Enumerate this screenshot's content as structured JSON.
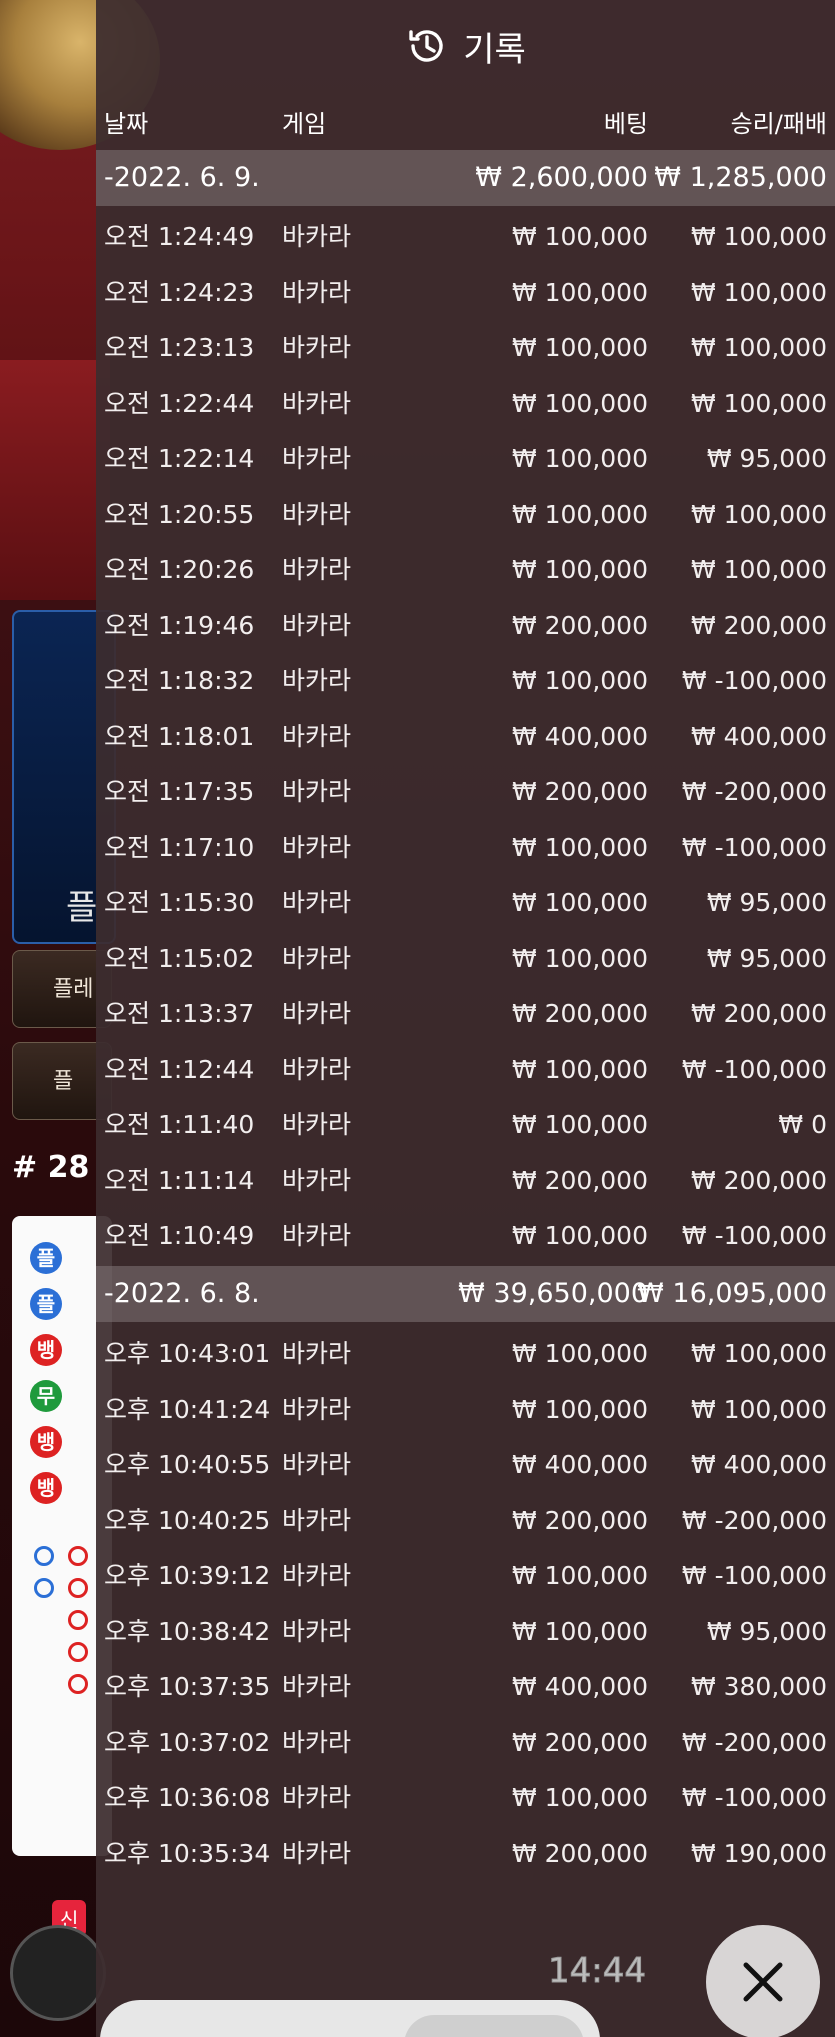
{
  "header": {
    "title": "기록"
  },
  "columns": {
    "date": "날짜",
    "game": "게임",
    "bet": "베팅",
    "result": "승리/패배"
  },
  "sections": [
    {
      "date": "-2022. 6. 9.",
      "bet_total": "₩ 2,600,000",
      "result_total": "₩ 1,285,000",
      "rows": [
        {
          "time": "오전 1:24:49",
          "game": "바카라",
          "bet": "₩ 100,000",
          "result": "₩ 100,000"
        },
        {
          "time": "오전 1:24:23",
          "game": "바카라",
          "bet": "₩ 100,000",
          "result": "₩ 100,000"
        },
        {
          "time": "오전 1:23:13",
          "game": "바카라",
          "bet": "₩ 100,000",
          "result": "₩ 100,000"
        },
        {
          "time": "오전 1:22:44",
          "game": "바카라",
          "bet": "₩ 100,000",
          "result": "₩ 100,000"
        },
        {
          "time": "오전 1:22:14",
          "game": "바카라",
          "bet": "₩ 100,000",
          "result": "₩ 95,000"
        },
        {
          "time": "오전 1:20:55",
          "game": "바카라",
          "bet": "₩ 100,000",
          "result": "₩ 100,000"
        },
        {
          "time": "오전 1:20:26",
          "game": "바카라",
          "bet": "₩ 100,000",
          "result": "₩ 100,000"
        },
        {
          "time": "오전 1:19:46",
          "game": "바카라",
          "bet": "₩ 200,000",
          "result": "₩ 200,000"
        },
        {
          "time": "오전 1:18:32",
          "game": "바카라",
          "bet": "₩ 100,000",
          "result": "₩ -100,000"
        },
        {
          "time": "오전 1:18:01",
          "game": "바카라",
          "bet": "₩ 400,000",
          "result": "₩ 400,000"
        },
        {
          "time": "오전 1:17:35",
          "game": "바카라",
          "bet": "₩ 200,000",
          "result": "₩ -200,000"
        },
        {
          "time": "오전 1:17:10",
          "game": "바카라",
          "bet": "₩ 100,000",
          "result": "₩ -100,000"
        },
        {
          "time": "오전 1:15:30",
          "game": "바카라",
          "bet": "₩ 100,000",
          "result": "₩ 95,000"
        },
        {
          "time": "오전 1:15:02",
          "game": "바카라",
          "bet": "₩ 100,000",
          "result": "₩ 95,000"
        },
        {
          "time": "오전 1:13:37",
          "game": "바카라",
          "bet": "₩ 200,000",
          "result": "₩ 200,000"
        },
        {
          "time": "오전 1:12:44",
          "game": "바카라",
          "bet": "₩ 100,000",
          "result": "₩ -100,000"
        },
        {
          "time": "오전 1:11:40",
          "game": "바카라",
          "bet": "₩ 100,000",
          "result": "₩ 0"
        },
        {
          "time": "오전 1:11:14",
          "game": "바카라",
          "bet": "₩ 200,000",
          "result": "₩ 200,000"
        },
        {
          "time": "오전 1:10:49",
          "game": "바카라",
          "bet": "₩ 100,000",
          "result": "₩ -100,000"
        }
      ]
    },
    {
      "date": "-2022. 6. 8.",
      "bet_total": "₩ 39,650,000",
      "result_total": "₩ 16,095,000",
      "rows": [
        {
          "time": "오후 10:43:01",
          "game": "바카라",
          "bet": "₩ 100,000",
          "result": "₩ 100,000"
        },
        {
          "time": "오후 10:41:24",
          "game": "바카라",
          "bet": "₩ 100,000",
          "result": "₩ 100,000"
        },
        {
          "time": "오후 10:40:55",
          "game": "바카라",
          "bet": "₩ 400,000",
          "result": "₩ 400,000"
        },
        {
          "time": "오후 10:40:25",
          "game": "바카라",
          "bet": "₩ 200,000",
          "result": "₩ -200,000"
        },
        {
          "time": "오후 10:39:12",
          "game": "바카라",
          "bet": "₩ 100,000",
          "result": "₩ -100,000"
        },
        {
          "time": "오후 10:38:42",
          "game": "바카라",
          "bet": "₩ 100,000",
          "result": "₩ 95,000"
        },
        {
          "time": "오후 10:37:35",
          "game": "바카라",
          "bet": "₩ 400,000",
          "result": "₩ 380,000"
        },
        {
          "time": "오후 10:37:02",
          "game": "바카라",
          "bet": "₩ 200,000",
          "result": "₩ -200,000"
        },
        {
          "time": "오후 10:36:08",
          "game": "바카라",
          "bet": "₩ 100,000",
          "result": "₩ -100,000"
        },
        {
          "time": "오후 10:35:34",
          "game": "바카라",
          "bet": "₩ 200,000",
          "result": "₩ 190,000"
        }
      ]
    }
  ],
  "clock": "14:44",
  "background": {
    "panel_label": "플",
    "btn_top": "플레",
    "btn_bottom": "플",
    "round": "# 28",
    "new_badge": "신",
    "beads": [
      "플",
      "플",
      "뱅",
      "무",
      "뱅",
      "뱅"
    ]
  },
  "icons": {
    "history": "history-icon",
    "close": "close-icon"
  },
  "colors": {
    "panel_bg": "#3c2c2e",
    "date_row_bg": "#827678",
    "text": "#ffffff"
  }
}
